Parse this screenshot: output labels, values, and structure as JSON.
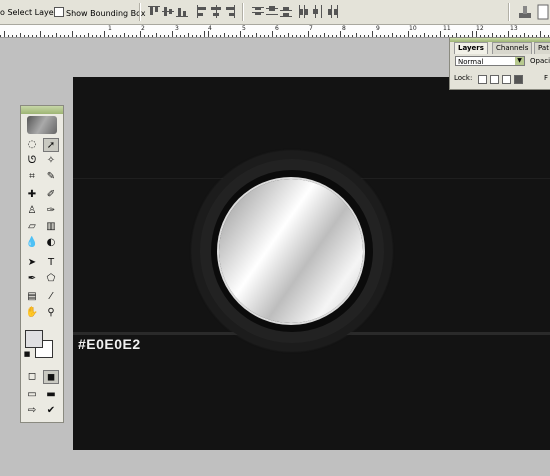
{
  "options_bar": {
    "auto_select_label": "o Select Layer",
    "show_bounding_box_label": "Show Bounding Box"
  },
  "ruler": {
    "numbers": [
      "1",
      "2",
      "3",
      "4",
      "5",
      "6",
      "7",
      "8",
      "9",
      "10",
      "11",
      "12",
      "13"
    ]
  },
  "canvas": {
    "color_label": "#E0E0E2",
    "background": "#131313",
    "disc_color": "#E0E0E2"
  },
  "toolbox": {
    "foreground_color": "#E0E0E2",
    "background_color": "#FFFFFF"
  },
  "layers_panel": {
    "tabs": [
      "Layers",
      "Channels",
      "Pat"
    ],
    "active_tab": "Layers",
    "blend_mode": "Normal",
    "opacity_label": "Opaci",
    "lock_label": "Lock:",
    "fill_label": "F",
    "accent": "#9EB574"
  }
}
